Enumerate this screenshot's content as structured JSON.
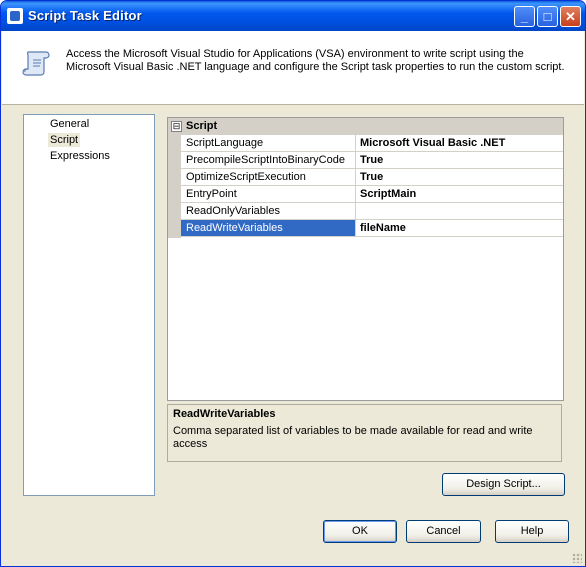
{
  "window": {
    "title": "Script Task Editor"
  },
  "titlebar_buttons": {
    "minimize": "_",
    "maximize": "□",
    "close": "✕"
  },
  "header": {
    "description": "Access the Microsoft Visual Studio for Applications (VSA) environment to write script using the Microsoft Visual Basic .NET language and configure the Script task properties to run the custom script."
  },
  "nav": {
    "items": [
      {
        "label": "General"
      },
      {
        "label": "Script",
        "selected": true
      },
      {
        "label": "Expressions"
      }
    ]
  },
  "grid": {
    "category": {
      "expander": "⊟",
      "label": "Script"
    },
    "properties": [
      {
        "name": "ScriptLanguage",
        "value": "Microsoft Visual Basic .NET"
      },
      {
        "name": "PrecompileScriptIntoBinaryCode",
        "value": "True"
      },
      {
        "name": "OptimizeScriptExecution",
        "value": "True"
      },
      {
        "name": "EntryPoint",
        "value": "ScriptMain"
      },
      {
        "name": "ReadOnlyVariables",
        "value": ""
      },
      {
        "name": "ReadWriteVariables",
        "value": "fileName",
        "selected": true
      }
    ]
  },
  "description_panel": {
    "title": "ReadWriteVariables",
    "text": "Comma separated list of variables to be made available for read and write access"
  },
  "buttons": {
    "design_script": "Design Script...",
    "ok": "OK",
    "cancel": "Cancel",
    "help": "Help"
  },
  "colors": {
    "selection": "#316ac5",
    "titlebar": "#0058ee",
    "dialog_face": "#ece9d8"
  }
}
